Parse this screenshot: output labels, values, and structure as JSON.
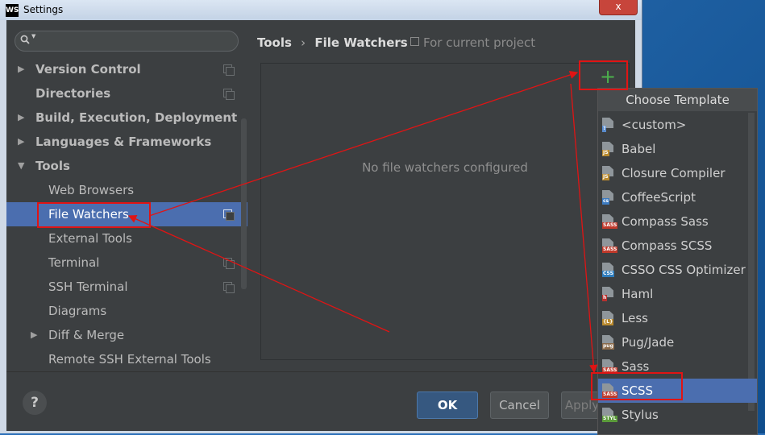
{
  "window": {
    "title": "Settings",
    "logo": "WS",
    "close_icon": "x"
  },
  "search": {
    "placeholder": ""
  },
  "sidebar": {
    "items": [
      {
        "label": "Version Control",
        "arrow": "▶",
        "bold": true
      },
      {
        "label": "Directories",
        "arrow": "",
        "bold": true
      },
      {
        "label": "Build, Execution, Deployment",
        "arrow": "▶",
        "bold": true
      },
      {
        "label": "Languages & Frameworks",
        "arrow": "▶",
        "bold": true
      },
      {
        "label": "Tools",
        "arrow": "▼",
        "bold": true
      },
      {
        "label": "Web Browsers"
      },
      {
        "label": "File Watchers",
        "selected": true
      },
      {
        "label": "External Tools"
      },
      {
        "label": "Terminal"
      },
      {
        "label": "SSH Terminal"
      },
      {
        "label": "Diagrams"
      },
      {
        "label": "Diff & Merge",
        "arrow": "▶"
      },
      {
        "label": "Remote SSH External Tools"
      }
    ]
  },
  "breadcrumb": {
    "parent": "Tools",
    "separator": "›",
    "current": "File Watchers",
    "scope": "For current project"
  },
  "panel": {
    "empty_text": "No file watchers configured",
    "add_icon": "+"
  },
  "footer": {
    "help": "?",
    "ok": "OK",
    "cancel": "Cancel",
    "apply": "Apply"
  },
  "popup": {
    "title": "Choose Template",
    "items": [
      {
        "label": "<custom>",
        "tag": "?",
        "color": "#5a8ccd"
      },
      {
        "label": "Babel",
        "tag": "JS",
        "color": "#b98a2f"
      },
      {
        "label": "Closure Compiler",
        "tag": "JS",
        "color": "#b98a2f"
      },
      {
        "label": "CoffeeScript",
        "tag": "cs",
        "color": "#3d7cc2"
      },
      {
        "label": "Compass Sass",
        "tag": "SASS",
        "color": "#c0392b"
      },
      {
        "label": "Compass SCSS",
        "tag": "SASS",
        "color": "#c0392b"
      },
      {
        "label": "CSSO CSS Optimizer",
        "tag": "CSS",
        "color": "#2f7dbd"
      },
      {
        "label": "Haml",
        "tag": "h",
        "color": "#b8312f"
      },
      {
        "label": "Less",
        "tag": "{L}",
        "color": "#b98a2f"
      },
      {
        "label": "Pug/Jade",
        "tag": "pug",
        "color": "#8a6a4a"
      },
      {
        "label": "Sass",
        "tag": "SASS",
        "color": "#c0392b"
      },
      {
        "label": "SCSS",
        "tag": "SASS",
        "color": "#c0392b",
        "selected": true
      },
      {
        "label": "Stylus",
        "tag": "STYL",
        "color": "#5b9b3a"
      }
    ]
  },
  "colors": {
    "selection": "#4b6eaf",
    "annotation": "#e01414",
    "add": "#4cb04c"
  }
}
